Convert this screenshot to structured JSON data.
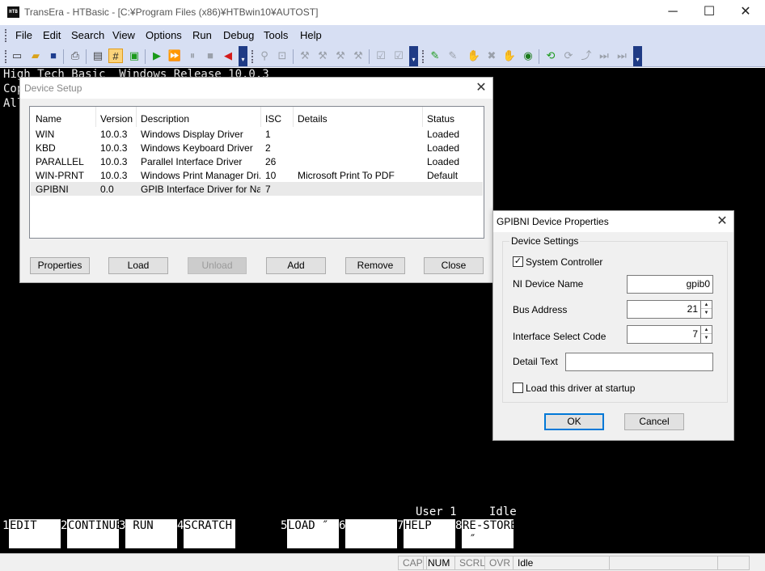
{
  "window": {
    "app_icon_text": "HTB",
    "title": "TransEra - HTBasic - [C:¥Program Files (x86)¥HTBwin10¥AUTOST]",
    "minimize": "─",
    "maximize": "☐",
    "close": "✕"
  },
  "menu": [
    "File",
    "Edit",
    "Search",
    "View",
    "Options",
    "Run",
    "Debug",
    "Tools",
    "Help"
  ],
  "console": {
    "line1": "High Tech Basic  Windows Release 10.0.3",
    "line2": "Cop",
    "line3": "All"
  },
  "softkeys": [
    {
      "num": "1",
      "label": "EDIT"
    },
    {
      "num": "2",
      "label": "CONTINUE"
    },
    {
      "num": "3",
      "label": " RUN"
    },
    {
      "num": "4",
      "label": "SCRATCH"
    },
    {
      "num": "5",
      "label": "LOAD ″"
    },
    {
      "num": "6",
      "label": ""
    },
    {
      "num": "7",
      "label": "HELP"
    },
    {
      "num": "8",
      "label": "RE-STORE\n ″"
    }
  ],
  "console_status": {
    "user": "User 1",
    "state": "Idle"
  },
  "statusbar": {
    "cap": "CAP",
    "num": "NUM",
    "scrl": "SCRL",
    "ovr": "OVR",
    "status": "Idle"
  },
  "device_setup": {
    "title": "Device Setup",
    "columns": [
      "Name",
      "Version",
      "Description",
      "ISC",
      "Details",
      "Status"
    ],
    "rows": [
      {
        "name": "WIN",
        "version": "10.0.3",
        "description": "Windows Display Driver",
        "isc": "1",
        "details": "",
        "status": "Loaded"
      },
      {
        "name": "KBD",
        "version": "10.0.3",
        "description": "Windows Keyboard Driver",
        "isc": "2",
        "details": "",
        "status": "Loaded"
      },
      {
        "name": "PARALLEL",
        "version": "10.0.3",
        "description": "Parallel Interface Driver",
        "isc": "26",
        "details": "",
        "status": "Loaded"
      },
      {
        "name": "WIN-PRNT",
        "version": "10.0.3",
        "description": "Windows Print Manager Dri...",
        "isc": "10",
        "details": "Microsoft Print To PDF",
        "status": "Default"
      },
      {
        "name": "GPIBNI",
        "version": "0.0",
        "description": "GPIB Interface Driver for Na...",
        "isc": "7",
        "details": "",
        "status": ""
      }
    ],
    "buttons": {
      "properties": "Properties",
      "load": "Load",
      "unload": "Unload",
      "add": "Add",
      "remove": "Remove",
      "close": "Close"
    }
  },
  "properties_dialog": {
    "title": "GPIBNI Device Properties",
    "group_label": "Device Settings",
    "system_controller_label": "System Controller",
    "system_controller_checked": true,
    "ni_device_name_label": "NI Device Name",
    "ni_device_name_value": "gpib0",
    "bus_address_label": "Bus Address",
    "bus_address_value": "21",
    "isc_label": "Interface Select Code",
    "isc_value": "7",
    "detail_text_label": "Detail Text",
    "detail_text_value": "",
    "load_at_startup_label": "Load this driver at startup",
    "load_at_startup_checked": false,
    "ok": "OK",
    "cancel": "Cancel"
  }
}
